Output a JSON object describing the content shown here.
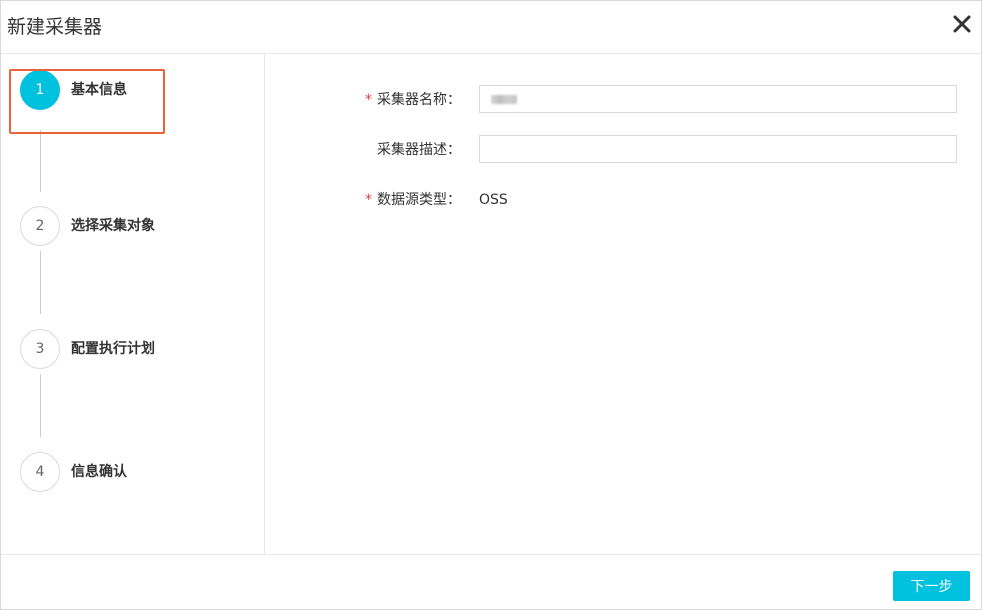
{
  "dialog": {
    "title": "新建采集器",
    "close_icon": "close-icon"
  },
  "steps": [
    {
      "number": "1",
      "label": "基本信息",
      "active": true
    },
    {
      "number": "2",
      "label": "选择采集对象",
      "active": false
    },
    {
      "number": "3",
      "label": "配置执行计划",
      "active": false
    },
    {
      "number": "4",
      "label": "信息确认",
      "active": false
    }
  ],
  "form": {
    "required_mark": "*",
    "name_label": "采集器名称：",
    "name_value": "",
    "desc_label": "采集器描述：",
    "desc_value": "",
    "source_label": "数据源类型：",
    "source_value": "OSS"
  },
  "footer": {
    "next_label": "下一步"
  },
  "colors": {
    "accent": "#00c1de",
    "required": "#e23c39",
    "highlight": "#e8623a"
  }
}
